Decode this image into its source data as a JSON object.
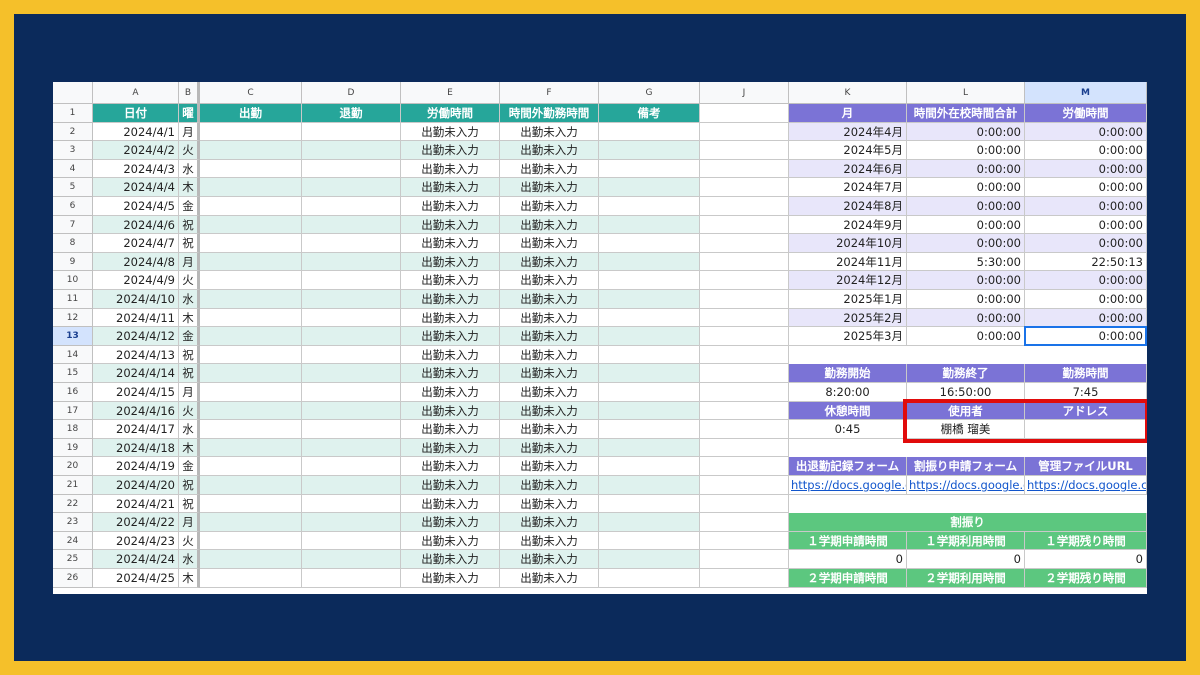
{
  "column_headers": [
    "A",
    "B",
    "C",
    "D",
    "E",
    "F",
    "G",
    "J",
    "K",
    "L",
    "M"
  ],
  "left_table": {
    "headers": [
      "日付",
      "曜",
      "出勤",
      "退勤",
      "労働時間",
      "時間外勤務時間",
      "備考"
    ],
    "rows": [
      {
        "date": "2024/4/1",
        "day": "月",
        "work": "出勤未入力",
        "overtime": "出勤未入力"
      },
      {
        "date": "2024/4/2",
        "day": "火",
        "work": "出勤未入力",
        "overtime": "出勤未入力"
      },
      {
        "date": "2024/4/3",
        "day": "水",
        "work": "出勤未入力",
        "overtime": "出勤未入力"
      },
      {
        "date": "2024/4/4",
        "day": "木",
        "work": "出勤未入力",
        "overtime": "出勤未入力"
      },
      {
        "date": "2024/4/5",
        "day": "金",
        "work": "出勤未入力",
        "overtime": "出勤未入力"
      },
      {
        "date": "2024/4/6",
        "day": "祝",
        "work": "出勤未入力",
        "overtime": "出勤未入力"
      },
      {
        "date": "2024/4/7",
        "day": "祝",
        "work": "出勤未入力",
        "overtime": "出勤未入力"
      },
      {
        "date": "2024/4/8",
        "day": "月",
        "work": "出勤未入力",
        "overtime": "出勤未入力"
      },
      {
        "date": "2024/4/9",
        "day": "火",
        "work": "出勤未入力",
        "overtime": "出勤未入力"
      },
      {
        "date": "2024/4/10",
        "day": "水",
        "work": "出勤未入力",
        "overtime": "出勤未入力"
      },
      {
        "date": "2024/4/11",
        "day": "木",
        "work": "出勤未入力",
        "overtime": "出勤未入力"
      },
      {
        "date": "2024/4/12",
        "day": "金",
        "work": "出勤未入力",
        "overtime": "出勤未入力"
      },
      {
        "date": "2024/4/13",
        "day": "祝",
        "work": "出勤未入力",
        "overtime": "出勤未入力"
      },
      {
        "date": "2024/4/14",
        "day": "祝",
        "work": "出勤未入力",
        "overtime": "出勤未入力"
      },
      {
        "date": "2024/4/15",
        "day": "月",
        "work": "出勤未入力",
        "overtime": "出勤未入力"
      },
      {
        "date": "2024/4/16",
        "day": "火",
        "work": "出勤未入力",
        "overtime": "出勤未入力"
      },
      {
        "date": "2024/4/17",
        "day": "水",
        "work": "出勤未入力",
        "overtime": "出勤未入力"
      },
      {
        "date": "2024/4/18",
        "day": "木",
        "work": "出勤未入力",
        "overtime": "出勤未入力"
      },
      {
        "date": "2024/4/19",
        "day": "金",
        "work": "出勤未入力",
        "overtime": "出勤未入力"
      },
      {
        "date": "2024/4/20",
        "day": "祝",
        "work": "出勤未入力",
        "overtime": "出勤未入力"
      },
      {
        "date": "2024/4/21",
        "day": "祝",
        "work": "出勤未入力",
        "overtime": "出勤未入力"
      },
      {
        "date": "2024/4/22",
        "day": "月",
        "work": "出勤未入力",
        "overtime": "出勤未入力"
      },
      {
        "date": "2024/4/23",
        "day": "火",
        "work": "出勤未入力",
        "overtime": "出勤未入力"
      },
      {
        "date": "2024/4/24",
        "day": "水",
        "work": "出勤未入力",
        "overtime": "出勤未入力"
      },
      {
        "date": "2024/4/25",
        "day": "木",
        "work": "出勤未入力",
        "overtime": "出勤未入力"
      }
    ]
  },
  "monthly": {
    "headers": [
      "月",
      "時間外在校時間合計",
      "労働時間"
    ],
    "rows": [
      {
        "month": "2024年4月",
        "overtime": "0:00:00",
        "work": "0:00:00"
      },
      {
        "month": "2024年5月",
        "overtime": "0:00:00",
        "work": "0:00:00"
      },
      {
        "month": "2024年6月",
        "overtime": "0:00:00",
        "work": "0:00:00"
      },
      {
        "month": "2024年7月",
        "overtime": "0:00:00",
        "work": "0:00:00"
      },
      {
        "month": "2024年8月",
        "overtime": "0:00:00",
        "work": "0:00:00"
      },
      {
        "month": "2024年9月",
        "overtime": "0:00:00",
        "work": "0:00:00"
      },
      {
        "month": "2024年10月",
        "overtime": "0:00:00",
        "work": "0:00:00"
      },
      {
        "month": "2024年11月",
        "overtime": "5:30:00",
        "work": "22:50:13"
      },
      {
        "month": "2024年12月",
        "overtime": "0:00:00",
        "work": "0:00:00"
      },
      {
        "month": "2025年1月",
        "overtime": "0:00:00",
        "work": "0:00:00"
      },
      {
        "month": "2025年2月",
        "overtime": "0:00:00",
        "work": "0:00:00"
      },
      {
        "month": "2025年3月",
        "overtime": "0:00:00",
        "work": "0:00:00"
      }
    ]
  },
  "schedule": {
    "h1": [
      "勤務開始",
      "勤務終了",
      "勤務時間"
    ],
    "v1": [
      "8:20:00",
      "16:50:00",
      "7:45"
    ],
    "h2": [
      "休憩時間",
      "使用者",
      "アドレス"
    ],
    "v2": [
      "0:45",
      "棚橋 瑠美",
      ""
    ]
  },
  "links": {
    "headers": [
      "出退勤記録フォーム",
      "割振り申請フォーム",
      "管理ファイルURL"
    ],
    "values": [
      "https://docs.google.com",
      "https://docs.google.com",
      "https://docs.google.com"
    ]
  },
  "warifuri": {
    "title": "割振り",
    "h1": [
      "１学期申請時間",
      "１学期利用時間",
      "１学期残り時間"
    ],
    "v1": [
      "0",
      "0",
      "0"
    ],
    "h2": [
      "２学期申請時間",
      "２学期利用時間",
      "２学期残り時間"
    ]
  },
  "colors": {
    "teal": "#26a69a",
    "purple": "#7b73d6",
    "green": "#5cc77f",
    "highlight": "#e10b0b"
  }
}
